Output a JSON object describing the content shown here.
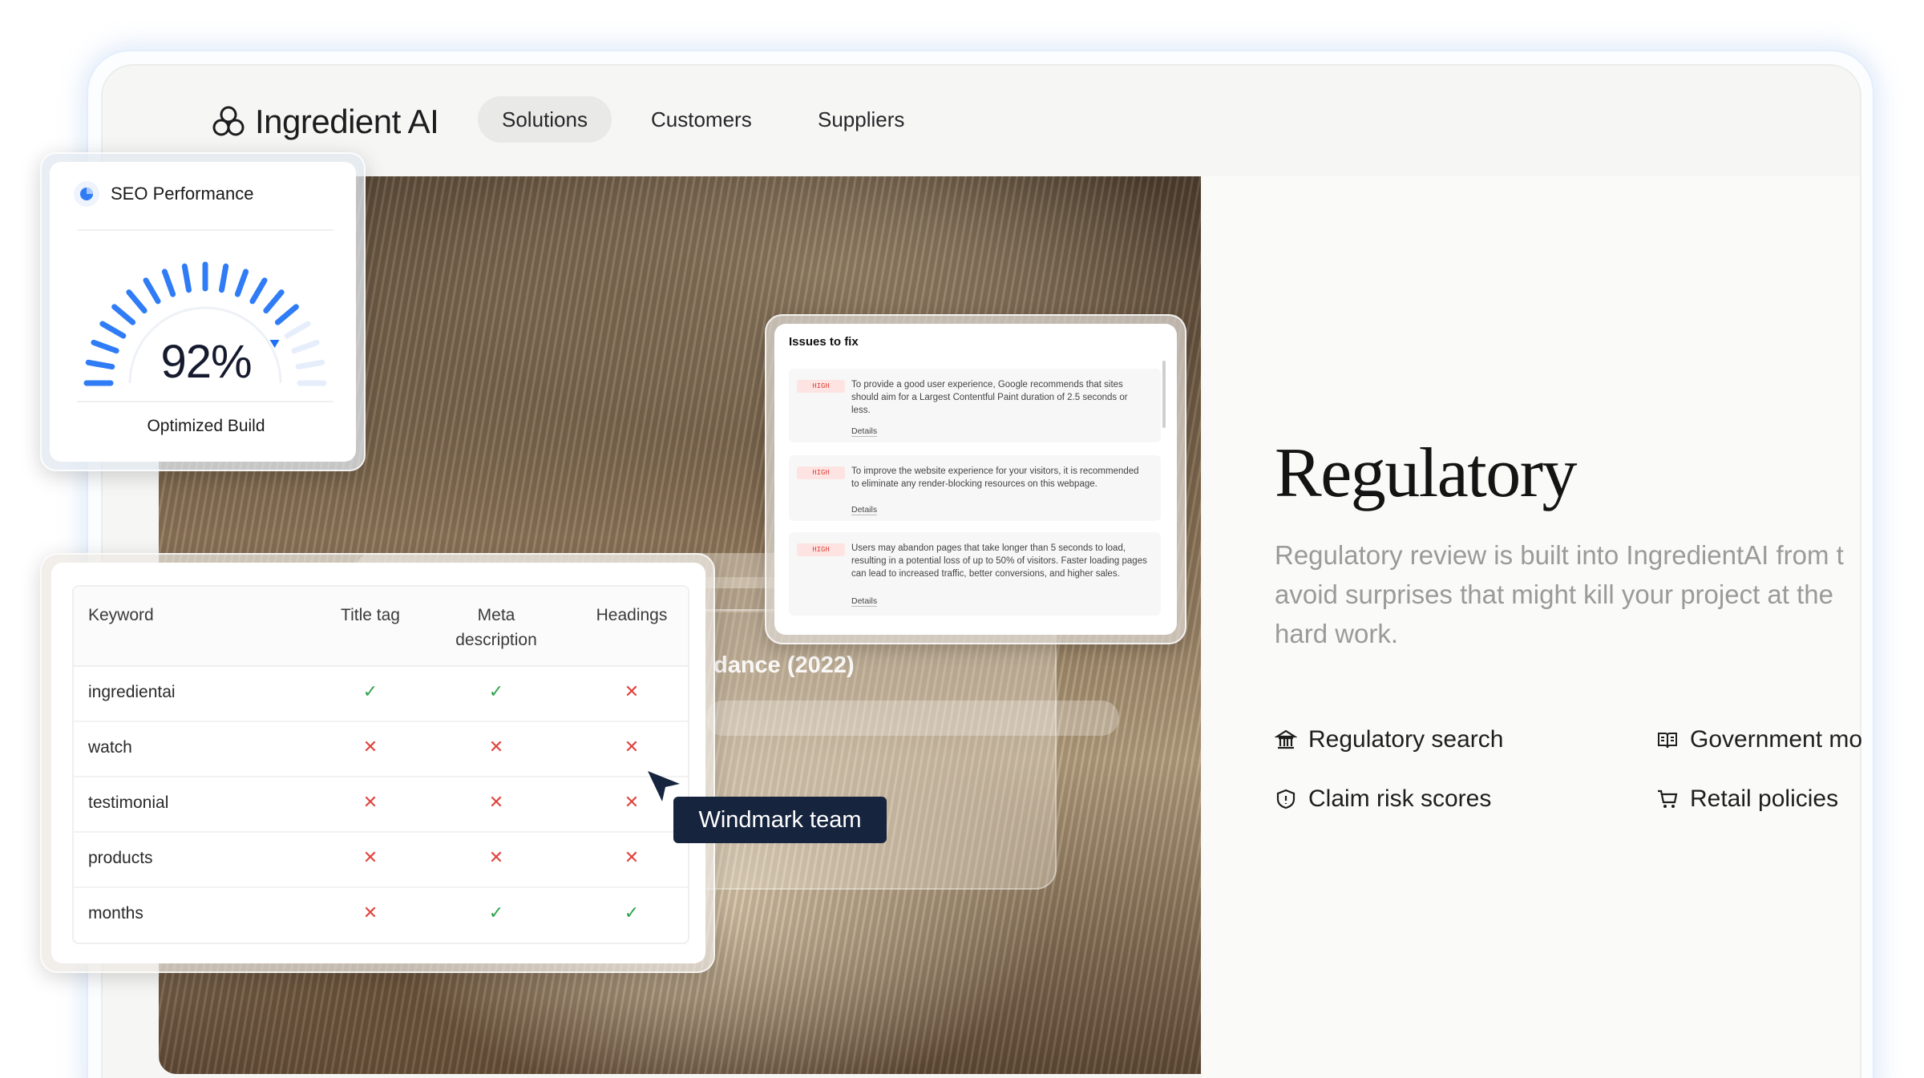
{
  "nav": {
    "brand": "Ingredient AI",
    "items": [
      {
        "label": "Solutions",
        "active": true
      },
      {
        "label": "Customers",
        "active": false
      },
      {
        "label": "Suppliers",
        "active": false
      }
    ]
  },
  "hero": {
    "caption": "dance (2022)"
  },
  "main": {
    "title": "Regulatory",
    "body_lines": [
      "Regulatory review is built into IngredientAI from t",
      "avoid surprises that might kill your project at the",
      "hard work."
    ],
    "features": [
      {
        "label": "Regulatory search",
        "icon": "bank-icon"
      },
      {
        "label": "Government mo",
        "icon": "book-icon"
      },
      {
        "label": "Claim risk scores",
        "icon": "shield-icon"
      },
      {
        "label": "Retail policies",
        "icon": "cart-icon"
      }
    ]
  },
  "seo_card": {
    "title": "SEO Performance",
    "value": "92%",
    "value_fraction": 0.92,
    "label": "Optimized Build",
    "accent_color": "#2f7cf6"
  },
  "keyword_table": {
    "headers": [
      "Keyword",
      "Title tag",
      "Meta description",
      "Headings"
    ],
    "rows": [
      {
        "keyword": "ingredientai",
        "title_tag": "✓",
        "meta": "✓",
        "headings": "✕"
      },
      {
        "keyword": "watch",
        "title_tag": "✕",
        "meta": "✕",
        "headings": "✕"
      },
      {
        "keyword": "testimonial",
        "title_tag": "✕",
        "meta": "✕",
        "headings": "✕"
      },
      {
        "keyword": "products",
        "title_tag": "✕",
        "meta": "✕",
        "headings": "✕"
      },
      {
        "keyword": "months",
        "title_tag": "✕",
        "meta": "✓",
        "headings": "✓"
      }
    ]
  },
  "issues_card": {
    "title": "Issues to fix",
    "items": [
      {
        "badge": "HIGH",
        "text": "To provide a good user experience, Google recommends that sites should aim for a Largest Contentful Paint duration of 2.5 seconds or less.",
        "link": "Details"
      },
      {
        "badge": "HIGH",
        "text": "To improve the website experience for your visitors, it is recommended to eliminate any render-blocking resources on this webpage.",
        "link": "Details"
      },
      {
        "badge": "HIGH",
        "text": "Users may abandon pages that take longer than 5 seconds to load, resulting in a potential loss of up to 50% of visitors. Faster loading pages can lead to increased traffic, better conversions, and higher sales.",
        "link": "Details"
      }
    ]
  },
  "tooltip": {
    "label": "Windmark team"
  }
}
